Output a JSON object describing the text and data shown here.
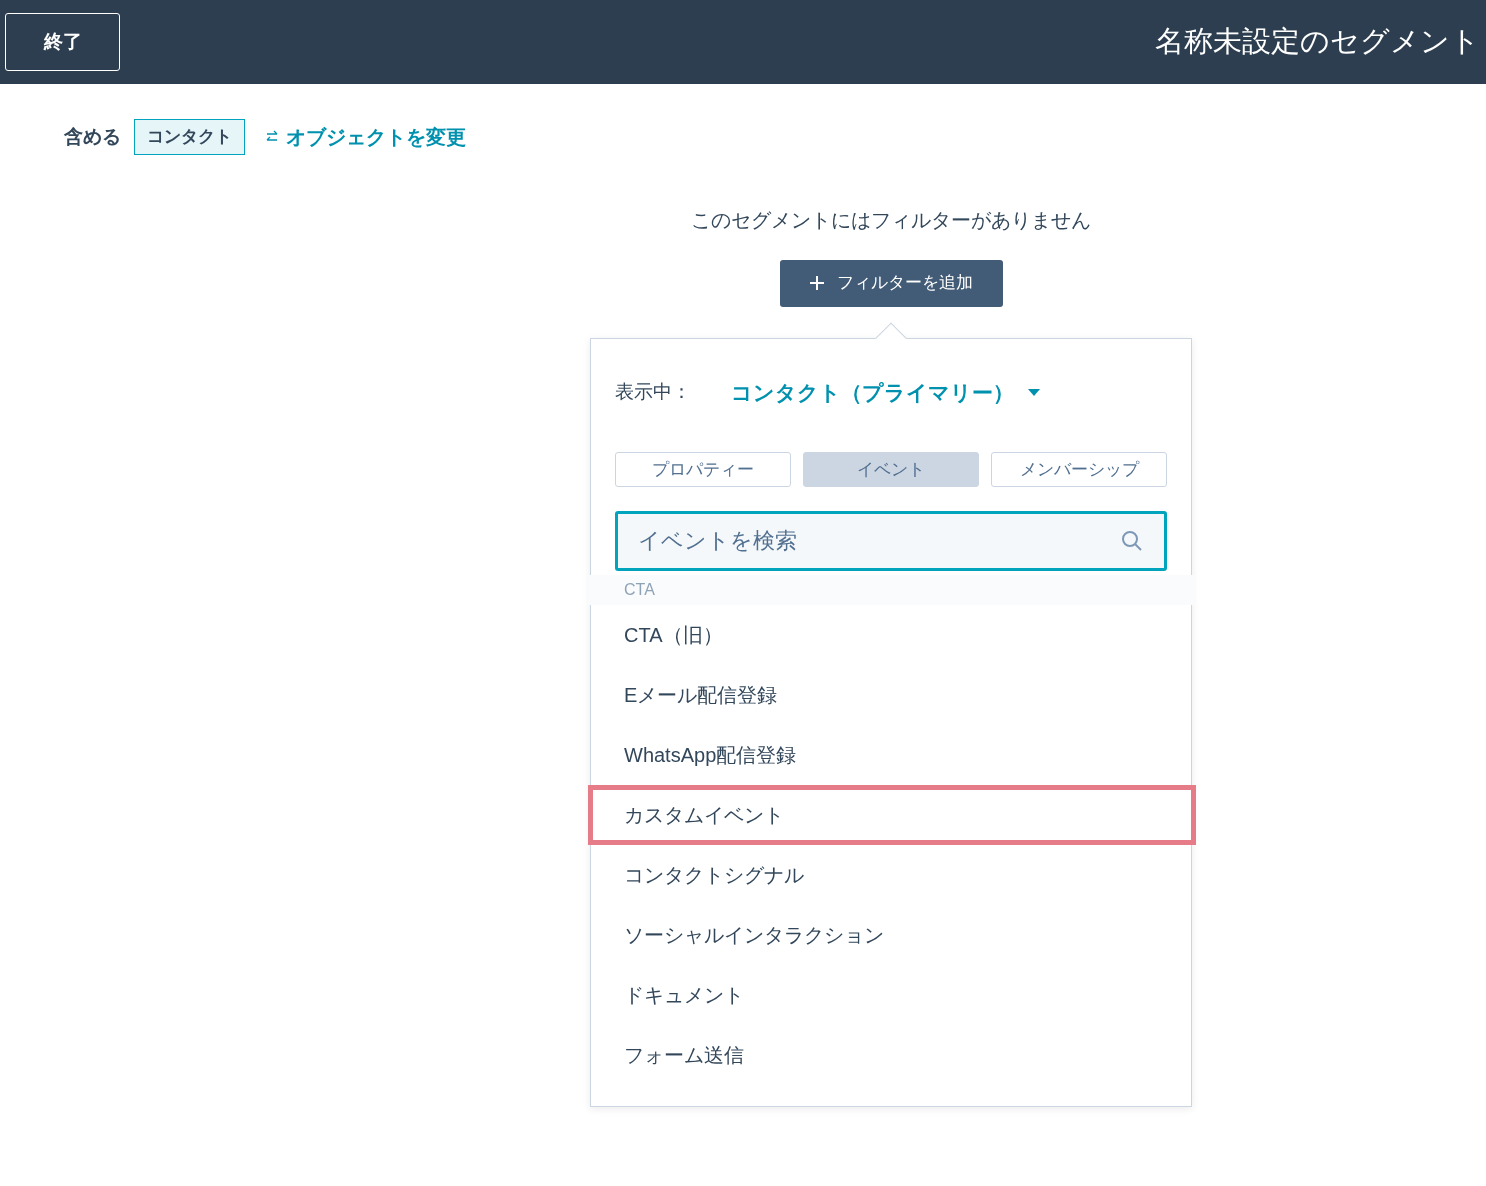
{
  "header": {
    "exit_button": "終了",
    "title": "名称未設定のセグメント"
  },
  "include": {
    "label": "含める",
    "object": "コンタクト",
    "change_link": "オブジェクトを変更"
  },
  "empty_message": "このセグメントにはフィルターがありません",
  "add_filter_button": "フィルターを追加",
  "popover": {
    "showing_label": "表示中：",
    "showing_value": "コンタクト（プライマリー）",
    "tabs": [
      {
        "label": "プロパティー",
        "selected": false
      },
      {
        "label": "イベント",
        "selected": true
      },
      {
        "label": "メンバーシップ",
        "selected": false
      }
    ],
    "search": {
      "placeholder": "イベントを検索"
    },
    "items": [
      {
        "label": "CTA",
        "faded": true,
        "highlighted": false
      },
      {
        "label": "CTA（旧）",
        "faded": false,
        "highlighted": false
      },
      {
        "label": "Eメール配信登録",
        "faded": false,
        "highlighted": false
      },
      {
        "label": "WhatsApp配信登録",
        "faded": false,
        "highlighted": false
      },
      {
        "label": "カスタムイベント",
        "faded": false,
        "highlighted": true
      },
      {
        "label": "コンタクトシグナル",
        "faded": false,
        "highlighted": false
      },
      {
        "label": "ソーシャルインタラクション",
        "faded": false,
        "highlighted": false
      },
      {
        "label": "ドキュメント",
        "faded": false,
        "highlighted": false
      },
      {
        "label": "フォーム送信",
        "faded": false,
        "highlighted": false
      }
    ]
  }
}
